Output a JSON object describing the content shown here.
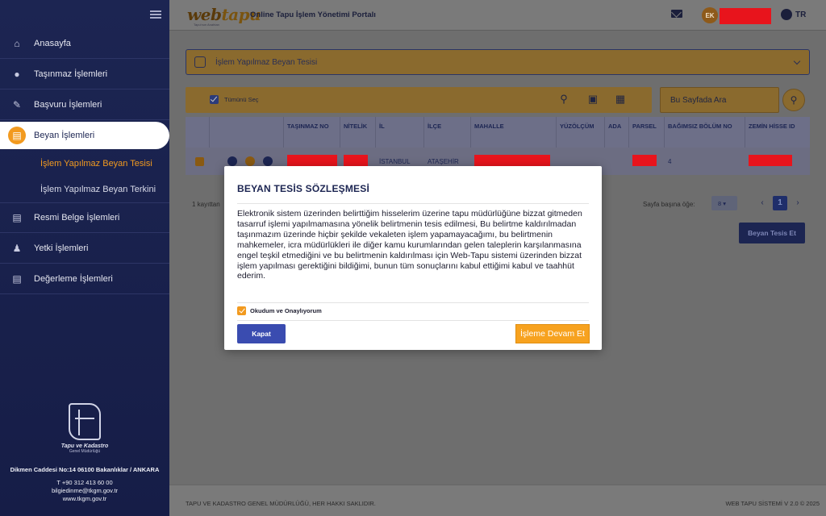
{
  "header": {
    "brand_web": "web",
    "brand_tapu": "tapu",
    "brand_tagline": "Tapu'nun Anahtarı",
    "portal_title": "Online Tapu İşlem Yönetimi Portalı",
    "avatar_initials": "EK",
    "language": "TR",
    "icons": [
      "mail-icon",
      "globe-icon",
      "menu-icon"
    ]
  },
  "sidebar": {
    "items": [
      {
        "label": "Anasayfa",
        "icon": "home-icon"
      },
      {
        "label": "Taşınmaz İşlemleri",
        "icon": "location-icon"
      },
      {
        "label": "Başvuru İşlemleri",
        "icon": "pen-icon"
      },
      {
        "label": "Beyan İşlemleri",
        "icon": "document-icon",
        "active": true
      },
      {
        "label": "Resmi Belge İşlemleri",
        "icon": "doc-icon"
      },
      {
        "label": "Yetki İşlemleri",
        "icon": "user-icon"
      },
      {
        "label": "Değerleme İşlemleri",
        "icon": "doc-icon"
      }
    ],
    "sub_items": [
      {
        "label": "İşlem Yapılmaz Beyan Tesisi",
        "active": true
      },
      {
        "label": "İşlem Yapılmaz Beyan Terkini"
      }
    ],
    "logo_text": "Tapu ve Kadastro",
    "logo_sub": "Genel Müdürlüğü",
    "address": "Dikmen Caddesi No:14 06100 Bakanlıklar / ANKARA",
    "phone": "T +90 312 413 60 00",
    "email": "bilgiedinme@tkgm.gov.tr",
    "website": "www.tkgm.gov.tr"
  },
  "main": {
    "section_title": "İşlem Yapılmaz Beyan Tesisi",
    "select_all": "Tümünü Seç",
    "search_placeholder": "Bu Sayfada Ara",
    "table": {
      "columns": [
        "TAŞINMAZ NO",
        "NİTELİK",
        "İL",
        "İLÇE",
        "MAHALLE",
        "YÜZÖLÇÜM",
        "ADA",
        "PARSEL",
        "BAĞIMSIZ BÖLÜM NO",
        "ZEMİN HİSSE ID"
      ],
      "rows": [
        {
          "il": "İSTANBUL",
          "ilce": "ATAŞEHİR",
          "bagimsiz_bolum": "4"
        }
      ]
    },
    "record_count": "1 kayıttan",
    "per_page_label": "Sayfa başına öğe:",
    "per_page_value": "8",
    "current_page": "1",
    "primary_button": "Beyan Tesis Et"
  },
  "footer": {
    "left": "TAPU VE KADASTRO GENEL MÜDÜRLÜĞÜ, HER HAKKI SAKLIDIR.",
    "right": "WEB TAPU SİSTEMİ V 2.0 © 2025"
  },
  "modal": {
    "title": "BEYAN TESİS SÖZLEŞMESİ",
    "body": "Elektronik sistem üzerinden belirttiğim hisselerim üzerine tapu müdürlüğüne bizzat gitmeden tasarruf işlemi yapılmamasına yönelik belirtmenin tesis edilmesi, Bu belirtme kaldırılmadan taşınmazım üzerinde hiçbir şekilde vekaleten işlem yapamayacağımı, bu belirtmenin mahkemeler, icra müdürlükleri ile diğer kamu kurumlarından gelen taleplerin karşılanmasına engel teşkil etmediğini ve bu belirtmenin kaldırılması için Web-Tapu sistemi üzerinden bizzat işlem yapılması gerektiğini bildiğimi, bunun tüm sonuçlarını kabul ettiğimi kabul ve taahhüt ederim.",
    "agree_label": "Okudum ve Onaylıyorum",
    "close_button": "Kapat",
    "continue_button": "İşleme Devam Et"
  },
  "colors": {
    "sidebar_bg": "#1c2552",
    "accent": "#f29a1f",
    "primary": "#3a4cb0",
    "redaction": "#e8141c"
  }
}
